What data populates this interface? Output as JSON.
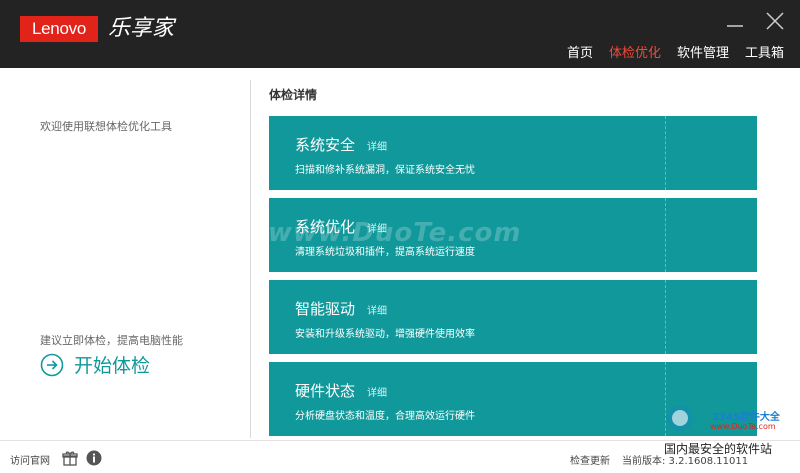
{
  "header": {
    "logo_text": "Lenovo",
    "app_name": "乐享家",
    "nav": [
      {
        "label": "首页"
      },
      {
        "label": "体检优化"
      },
      {
        "label": "软件管理"
      },
      {
        "label": "工具箱"
      }
    ],
    "active_nav": "体检优化"
  },
  "left": {
    "welcome": "欢迎使用联想体检优化工具",
    "suggest": "建议立即体检，提高电脑性能",
    "start_label": "开始体检"
  },
  "main": {
    "detail_title": "体检详情",
    "cards": [
      {
        "title": "系统安全",
        "link": "详细",
        "desc": "扫描和修补系统漏洞，保证系统安全无忧"
      },
      {
        "title": "系统优化",
        "link": "详细",
        "desc": "清理系统垃圾和插件，提高系统运行速度"
      },
      {
        "title": "智能驱动",
        "link": "详细",
        "desc": "安装和升级系统驱动，增强硬件使用效率"
      },
      {
        "title": "硬件状态",
        "link": "详细",
        "desc": "分析硬盘状态和温度，合理高效运行硬件"
      }
    ]
  },
  "footer": {
    "visit_site": "访问官网",
    "check_update": "检查更新",
    "version": "当前版本: 3.2.1608.11011"
  },
  "watermark": {
    "center": "www.DuoTe.com",
    "corner_brand": "2345软件大全",
    "corner_url": "www.DuoTe.com",
    "corner_slogan": "国内最安全的软件站"
  },
  "colors": {
    "titlebar": "#232323",
    "accent": "#11989a",
    "active_nav": "#f04a3a",
    "logo_red": "#e2231a"
  }
}
